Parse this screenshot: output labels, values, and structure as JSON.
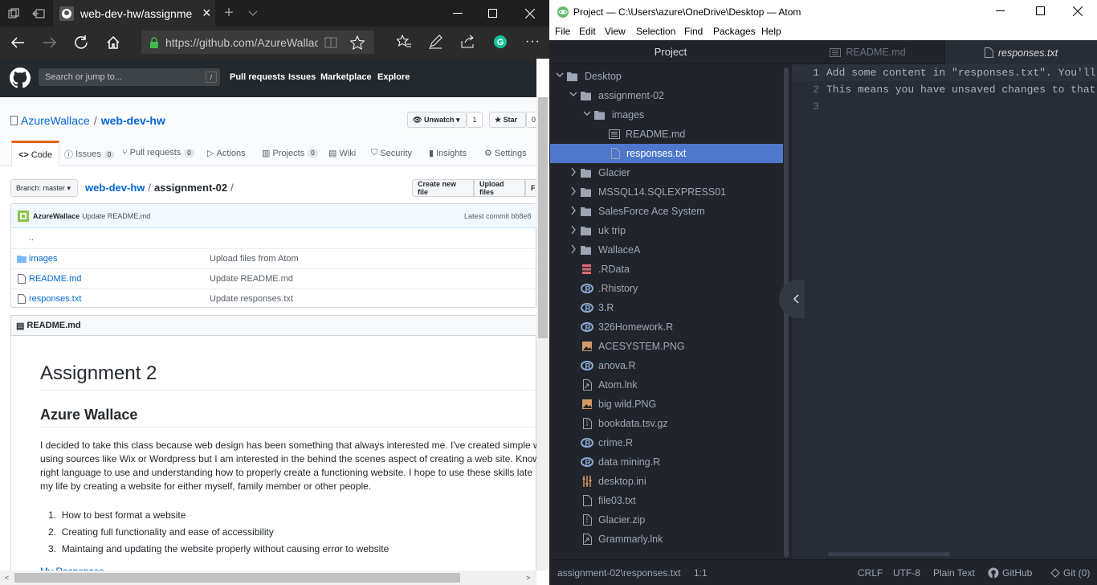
{
  "edge": {
    "tab_title": "web-dev-hw/assignmer",
    "url": "https://github.com/AzureWallac",
    "github": {
      "search_placeholder": "Search or jump to...",
      "search_key": "/",
      "nav": [
        "Pull requests",
        "Issues",
        "Marketplace",
        "Explore"
      ],
      "owner": "AzureWallace",
      "sep": "/",
      "repo": "web-dev-hw",
      "unwatch_label": "Unwatch",
      "watch_count": "1",
      "star_label": "Star",
      "star_count": "0",
      "tabs": [
        {
          "label": "Code"
        },
        {
          "label": "Issues",
          "count": "0"
        },
        {
          "label": "Pull requests",
          "count": "0"
        },
        {
          "label": "Actions"
        },
        {
          "label": "Projects",
          "count": "0"
        },
        {
          "label": "Wiki"
        },
        {
          "label": "Security"
        },
        {
          "label": "Insights"
        },
        {
          "label": "Settings"
        }
      ],
      "branch_label": "Branch: master",
      "path_repo": "web-dev-hw",
      "path_sep": "/",
      "path_dir": "assignment-02",
      "path_trail": "/",
      "create_file": "Create new file",
      "upload_files": "Upload files",
      "find_file": "F",
      "commit_author": "AzureWallace",
      "commit_msg": "Update README.md",
      "latest_commit": "Latest commit bb8e8",
      "parent": "..",
      "files": [
        {
          "name": "images",
          "msg": "Upload files from Atom",
          "icon": "folder-icon"
        },
        {
          "name": "README.md",
          "msg": "Update README.md",
          "icon": "file-icon"
        },
        {
          "name": "responses.txt",
          "msg": "Update responses.txt",
          "icon": "file-icon"
        }
      ],
      "readme_label": "README.md",
      "readme": {
        "h1": "Assignment 2",
        "h2": "Azure Wallace",
        "para": [
          "I decided to take this class because web design has been something that always interested me. I've created simple we",
          "using sources like Wix or Wordpress but I am interested in the behind the scenes aspect of creating a web site. Know",
          "right language to use and understanding how to properly create a functioning website. I hope to use these skills late",
          "my life by creating a website for either myself, family member or other people."
        ],
        "list": [
          "How to best format a website",
          "Creating full functionality and ease of accessibility",
          "Maintaing and updating the website properly without causing error to website"
        ],
        "link": "My Responses"
      }
    }
  },
  "atom": {
    "title": "Project — C:\\Users\\azure\\OneDrive\\Desktop — Atom",
    "menu": [
      "File",
      "Edit",
      "View",
      "Selection",
      "Find",
      "Packages",
      "Help"
    ],
    "tree_title": "Project",
    "tree": [
      {
        "label": "Desktop",
        "type": "dir-open"
      },
      {
        "label": "assignment-02",
        "type": "dir-open"
      },
      {
        "label": "images",
        "type": "dir-open"
      },
      {
        "label": "README.md",
        "type": "md"
      },
      {
        "label": "responses.txt",
        "type": "txt"
      },
      {
        "label": "Glacier",
        "type": "dir"
      },
      {
        "label": "MSSQL14.SQLEXPRESS01",
        "type": "dir"
      },
      {
        "label": "SalesForce Ace System",
        "type": "dir"
      },
      {
        "label": "uk trip",
        "type": "dir"
      },
      {
        "label": "WallaceA",
        "type": "dir"
      },
      {
        "label": ".RData",
        "type": "rdata"
      },
      {
        "label": ".Rhistory",
        "type": "r"
      },
      {
        "label": "3.R",
        "type": "r"
      },
      {
        "label": "326Homework.R",
        "type": "r"
      },
      {
        "label": "ACESYSTEM.PNG",
        "type": "img"
      },
      {
        "label": "anova.R",
        "type": "r"
      },
      {
        "label": "Atom.lnk",
        "type": "lnk"
      },
      {
        "label": "big wild.PNG",
        "type": "img"
      },
      {
        "label": "bookdata.tsv.gz",
        "type": "zip"
      },
      {
        "label": "crime.R",
        "type": "r"
      },
      {
        "label": "data mining.R",
        "type": "r"
      },
      {
        "label": "desktop.ini",
        "type": "ini"
      },
      {
        "label": "file03.txt",
        "type": "txt"
      },
      {
        "label": "Glacier.zip",
        "type": "zip"
      },
      {
        "label": "Grammarly.lnk",
        "type": "lnk"
      }
    ],
    "tabs": [
      "README.md",
      "responses.txt"
    ],
    "lines": [
      "Add some content in \"responses.txt\". You'll",
      "This means you have unsaved changes to that"
    ],
    "line_numbers": [
      "1",
      "2",
      "3"
    ],
    "status": {
      "path": "assignment-02\\responses.txt",
      "cursor": "1:1",
      "eol": "CRLF",
      "encoding": "UTF-8",
      "grammar": "Plain Text",
      "github": "GitHub",
      "git": "Git (0)"
    }
  }
}
